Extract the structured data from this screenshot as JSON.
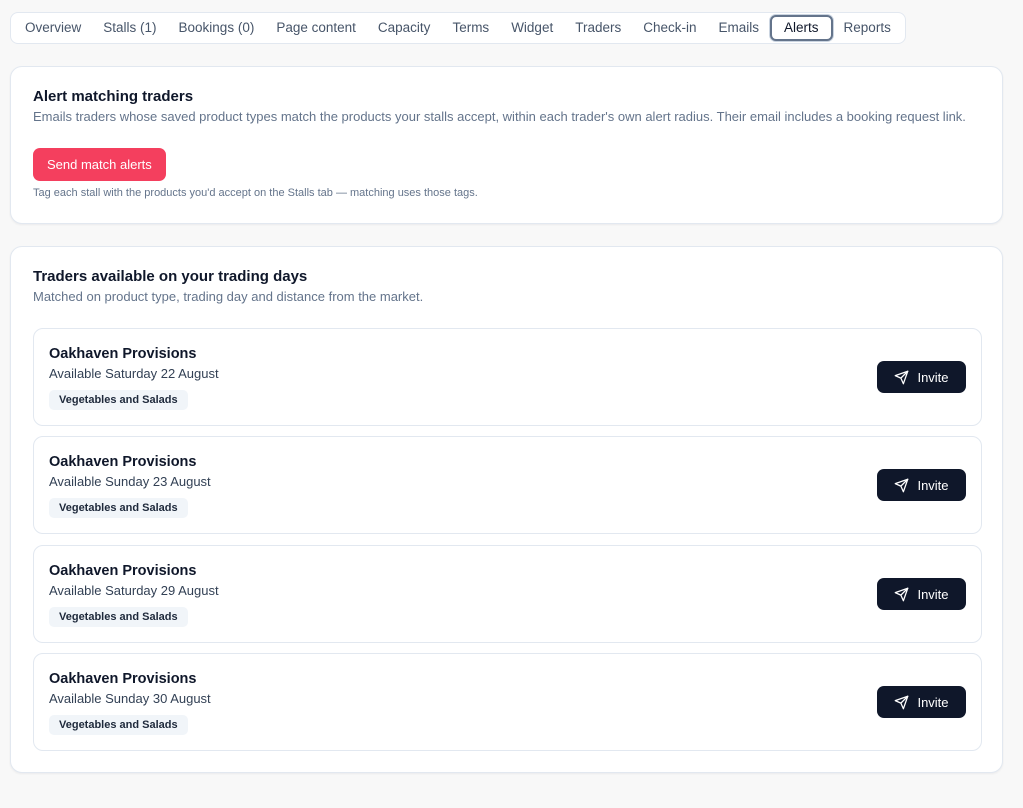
{
  "tabs": [
    {
      "label": "Overview"
    },
    {
      "label": "Stalls (1)"
    },
    {
      "label": "Bookings (0)"
    },
    {
      "label": "Page content"
    },
    {
      "label": "Capacity"
    },
    {
      "label": "Terms"
    },
    {
      "label": "Widget"
    },
    {
      "label": "Traders"
    },
    {
      "label": "Check-in"
    },
    {
      "label": "Emails"
    },
    {
      "label": "Alerts",
      "active": true
    },
    {
      "label": "Reports"
    }
  ],
  "alert_card": {
    "title": "Alert matching traders",
    "description": "Emails traders whose saved product types match the products your stalls accept, within each trader's own alert radius. Their email includes a booking request link.",
    "button_label": "Send match alerts",
    "hint": "Tag each stall with the products you'd accept on the Stalls tab — matching uses those tags."
  },
  "traders_card": {
    "title": "Traders available on your trading days",
    "description": "Matched on product type, trading day and distance from the market.",
    "items": [
      {
        "name": "Oakhaven Provisions",
        "availability": "Available Saturday 22 August",
        "tag": "Vegetables and Salads",
        "button_label": "Invite",
        "icon": "send-icon"
      },
      {
        "name": "Oakhaven Provisions",
        "availability": "Available Sunday 23 August",
        "tag": "Vegetables and Salads",
        "button_label": "Invite",
        "icon": "send-icon"
      },
      {
        "name": "Oakhaven Provisions",
        "availability": "Available Saturday 29 August",
        "tag": "Vegetables and Salads",
        "button_label": "Invite",
        "icon": "send-icon"
      },
      {
        "name": "Oakhaven Provisions",
        "availability": "Available Sunday 30 August",
        "tag": "Vegetables and Salads",
        "button_label": "Invite",
        "icon": "send-icon"
      }
    ]
  },
  "colors": {
    "accent": "#f43f5e",
    "primary_button": "#0f172a",
    "tag_background": "#f1f5f9"
  }
}
